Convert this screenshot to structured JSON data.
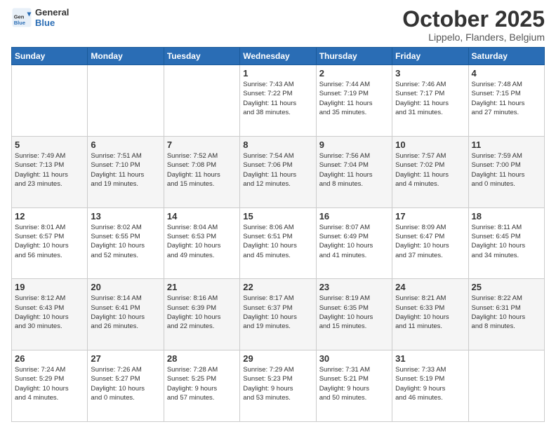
{
  "logo": {
    "general": "General",
    "blue": "Blue"
  },
  "header": {
    "month": "October 2025",
    "location": "Lippelo, Flanders, Belgium"
  },
  "weekdays": [
    "Sunday",
    "Monday",
    "Tuesday",
    "Wednesday",
    "Thursday",
    "Friday",
    "Saturday"
  ],
  "weeks": [
    [
      {
        "day": "",
        "info": ""
      },
      {
        "day": "",
        "info": ""
      },
      {
        "day": "",
        "info": ""
      },
      {
        "day": "1",
        "info": "Sunrise: 7:43 AM\nSunset: 7:22 PM\nDaylight: 11 hours\nand 38 minutes."
      },
      {
        "day": "2",
        "info": "Sunrise: 7:44 AM\nSunset: 7:19 PM\nDaylight: 11 hours\nand 35 minutes."
      },
      {
        "day": "3",
        "info": "Sunrise: 7:46 AM\nSunset: 7:17 PM\nDaylight: 11 hours\nand 31 minutes."
      },
      {
        "day": "4",
        "info": "Sunrise: 7:48 AM\nSunset: 7:15 PM\nDaylight: 11 hours\nand 27 minutes."
      }
    ],
    [
      {
        "day": "5",
        "info": "Sunrise: 7:49 AM\nSunset: 7:13 PM\nDaylight: 11 hours\nand 23 minutes."
      },
      {
        "day": "6",
        "info": "Sunrise: 7:51 AM\nSunset: 7:10 PM\nDaylight: 11 hours\nand 19 minutes."
      },
      {
        "day": "7",
        "info": "Sunrise: 7:52 AM\nSunset: 7:08 PM\nDaylight: 11 hours\nand 15 minutes."
      },
      {
        "day": "8",
        "info": "Sunrise: 7:54 AM\nSunset: 7:06 PM\nDaylight: 11 hours\nand 12 minutes."
      },
      {
        "day": "9",
        "info": "Sunrise: 7:56 AM\nSunset: 7:04 PM\nDaylight: 11 hours\nand 8 minutes."
      },
      {
        "day": "10",
        "info": "Sunrise: 7:57 AM\nSunset: 7:02 PM\nDaylight: 11 hours\nand 4 minutes."
      },
      {
        "day": "11",
        "info": "Sunrise: 7:59 AM\nSunset: 7:00 PM\nDaylight: 11 hours\nand 0 minutes."
      }
    ],
    [
      {
        "day": "12",
        "info": "Sunrise: 8:01 AM\nSunset: 6:57 PM\nDaylight: 10 hours\nand 56 minutes."
      },
      {
        "day": "13",
        "info": "Sunrise: 8:02 AM\nSunset: 6:55 PM\nDaylight: 10 hours\nand 52 minutes."
      },
      {
        "day": "14",
        "info": "Sunrise: 8:04 AM\nSunset: 6:53 PM\nDaylight: 10 hours\nand 49 minutes."
      },
      {
        "day": "15",
        "info": "Sunrise: 8:06 AM\nSunset: 6:51 PM\nDaylight: 10 hours\nand 45 minutes."
      },
      {
        "day": "16",
        "info": "Sunrise: 8:07 AM\nSunset: 6:49 PM\nDaylight: 10 hours\nand 41 minutes."
      },
      {
        "day": "17",
        "info": "Sunrise: 8:09 AM\nSunset: 6:47 PM\nDaylight: 10 hours\nand 37 minutes."
      },
      {
        "day": "18",
        "info": "Sunrise: 8:11 AM\nSunset: 6:45 PM\nDaylight: 10 hours\nand 34 minutes."
      }
    ],
    [
      {
        "day": "19",
        "info": "Sunrise: 8:12 AM\nSunset: 6:43 PM\nDaylight: 10 hours\nand 30 minutes."
      },
      {
        "day": "20",
        "info": "Sunrise: 8:14 AM\nSunset: 6:41 PM\nDaylight: 10 hours\nand 26 minutes."
      },
      {
        "day": "21",
        "info": "Sunrise: 8:16 AM\nSunset: 6:39 PM\nDaylight: 10 hours\nand 22 minutes."
      },
      {
        "day": "22",
        "info": "Sunrise: 8:17 AM\nSunset: 6:37 PM\nDaylight: 10 hours\nand 19 minutes."
      },
      {
        "day": "23",
        "info": "Sunrise: 8:19 AM\nSunset: 6:35 PM\nDaylight: 10 hours\nand 15 minutes."
      },
      {
        "day": "24",
        "info": "Sunrise: 8:21 AM\nSunset: 6:33 PM\nDaylight: 10 hours\nand 11 minutes."
      },
      {
        "day": "25",
        "info": "Sunrise: 8:22 AM\nSunset: 6:31 PM\nDaylight: 10 hours\nand 8 minutes."
      }
    ],
    [
      {
        "day": "26",
        "info": "Sunrise: 7:24 AM\nSunset: 5:29 PM\nDaylight: 10 hours\nand 4 minutes."
      },
      {
        "day": "27",
        "info": "Sunrise: 7:26 AM\nSunset: 5:27 PM\nDaylight: 10 hours\nand 0 minutes."
      },
      {
        "day": "28",
        "info": "Sunrise: 7:28 AM\nSunset: 5:25 PM\nDaylight: 9 hours\nand 57 minutes."
      },
      {
        "day": "29",
        "info": "Sunrise: 7:29 AM\nSunset: 5:23 PM\nDaylight: 9 hours\nand 53 minutes."
      },
      {
        "day": "30",
        "info": "Sunrise: 7:31 AM\nSunset: 5:21 PM\nDaylight: 9 hours\nand 50 minutes."
      },
      {
        "day": "31",
        "info": "Sunrise: 7:33 AM\nSunset: 5:19 PM\nDaylight: 9 hours\nand 46 minutes."
      },
      {
        "day": "",
        "info": ""
      }
    ]
  ]
}
